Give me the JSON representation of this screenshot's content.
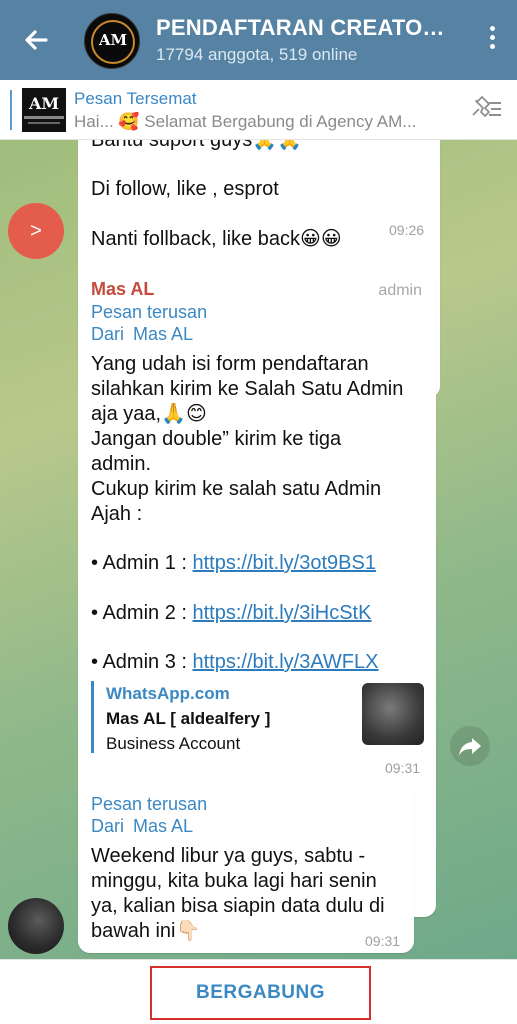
{
  "header": {
    "title": "PENDAFTARAN CREATOR...",
    "subtitle": "17794 anggota, 519 online",
    "avatar_text": "AM"
  },
  "pinned": {
    "title": "Pesan Tersemat",
    "text": "Hai... 🥰 Selamat Bergabung di  Agency AM...",
    "thumb_text": "AM"
  },
  "messages": [
    {
      "lines": [
        "Bantu suport guys🙏🙏",
        "",
        "Di follow, like , esprot",
        "",
        "Nanti follback, like back😀😀"
      ],
      "time": "09:26"
    },
    {
      "sender": "Mas AL",
      "role": "admin",
      "forward_label": "Pesan terusan",
      "forward_from_prefix": "Dari",
      "forward_from": "Mas AL",
      "lines": [
        "Yang udah isi form pendaftaran",
        "silahkan kirim ke Salah Satu Admin",
        "aja yaa,🙏😊",
        "Jangan double” kirim ke tiga",
        "admin.",
        "Cukup kirim ke salah satu Admin",
        "Ajah :"
      ],
      "admins": [
        {
          "label": "• Admin 1 : ",
          "link": "https://bit.ly/3ot9BS1"
        },
        {
          "label": "• Admin 2 : ",
          "link": "https://bit.ly/3iHcStK"
        },
        {
          "label": "• Admin 3 : ",
          "link": "https://bit.ly/3AWFLX"
        }
      ],
      "preview": {
        "site": "WhatsApp.com",
        "name": "Mas AL [ aldealfery ]",
        "desc": "Business Account"
      },
      "time": "09:31"
    },
    {
      "forward_label": "Pesan terusan",
      "forward_from_prefix": "Dari",
      "forward_from": "Mas AL",
      "lines": [
        "Weekend libur ya guys, sabtu -",
        "minggu, kita buka lagi hari senin",
        "ya, kalian bisa siapin data dulu di",
        "bawah ini👇🏻"
      ],
      "time": "09:31"
    }
  ],
  "jump_button": ">",
  "join_button": "BERGABUNG",
  "colors": {
    "header": "#5682a3",
    "accent": "#3b88c3",
    "sender": "#c54b3c",
    "join_border": "#d32f2f"
  }
}
